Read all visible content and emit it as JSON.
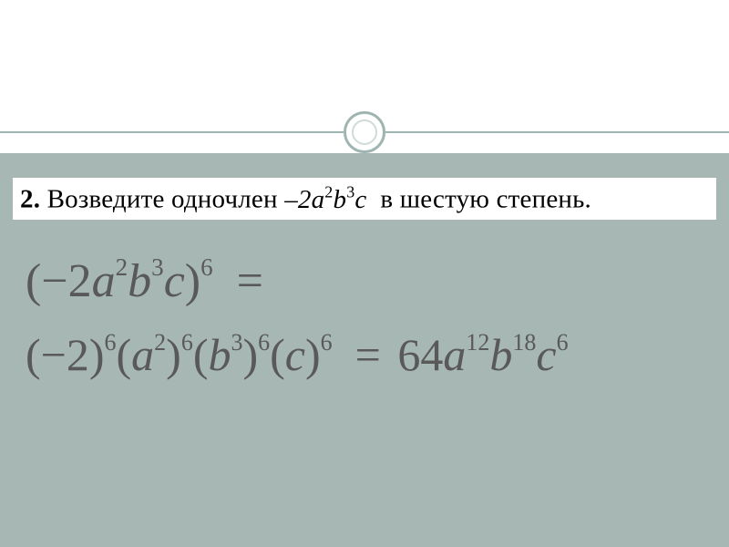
{
  "problem": {
    "number": "2.",
    "text_before": "Возведите одночлен",
    "expr_coef": "–2",
    "expr_a": "a",
    "expr_a_pow": "2",
    "expr_b": "b",
    "expr_b_pow": "3",
    "expr_c": "c",
    "text_after": "в шестую степень."
  },
  "equation1": {
    "open": "(",
    "minus": "−",
    "coef": "2",
    "a": "a",
    "a_pow": "2",
    "b": "b",
    "b_pow": "3",
    "c": "c",
    "close": ")",
    "outer_pow": "6",
    "eq": "="
  },
  "equation2": {
    "p1_open": "(",
    "p1_minus": "−",
    "p1_val": "2",
    "p1_close": ")",
    "p1_pow": "6",
    "p2_open": "(",
    "p2_base": "a",
    "p2_inner_pow": "2",
    "p2_close": ")",
    "p2_pow": "6",
    "p3_open": "(",
    "p3_base": "b",
    "p3_inner_pow": "3",
    "p3_close": ")",
    "p3_pow": "6",
    "p4_open": "(",
    "p4_base": "c",
    "p4_close": ")",
    "p4_pow": "6",
    "eq": "=",
    "res_coef": "64",
    "res_a": "a",
    "res_a_pow": "12",
    "res_b": "b",
    "res_b_pow": "18",
    "res_c": "c",
    "res_c_pow": "6"
  }
}
